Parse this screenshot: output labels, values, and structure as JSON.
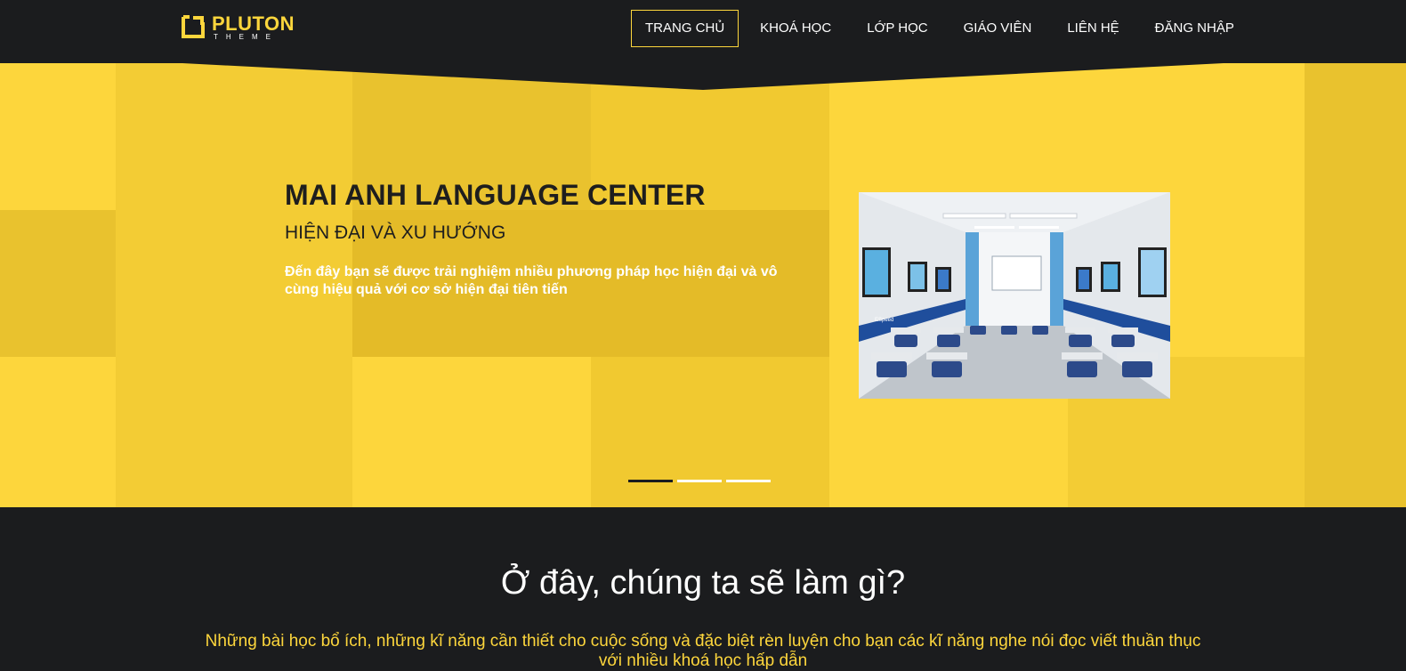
{
  "logo": {
    "name": "PLUTON",
    "sub": "THEME"
  },
  "nav": {
    "items": [
      {
        "label": "TRANG CHỦ"
      },
      {
        "label": "KHOÁ HỌC"
      },
      {
        "label": "LỚP HỌC"
      },
      {
        "label": "GIÁO VIÊN"
      },
      {
        "label": "LIÊN HỆ"
      },
      {
        "label": "ĐĂNG NHẬP"
      }
    ],
    "active_index": 0
  },
  "hero": {
    "title": "MAI ANH LANGUAGE CENTER",
    "subtitle": "HIỆN ĐẠI VÀ XU HƯỚNG",
    "description": "Đến đây bạn sẽ được trải nghiệm nhiều phương pháp học hiện đại và vô cùng hiệu quả với cơ sở hiện đại tiên tiến",
    "classroom_sign_text": "ESpeed",
    "slides_count": 3,
    "active_slide": 0
  },
  "section": {
    "title": "Ở đây, chúng ta sẽ làm gì?",
    "description": "Những bài học bổ ích, những kĩ năng cần thiết cho cuộc sống và đặc biệt rèn luyện cho bạn các kĩ năng nghe nói đọc viết thuần thục với nhiều khoá học hấp dẫn"
  },
  "colors": {
    "accent": "#fdd63c",
    "dark": "#1b1c1e",
    "tile_dark": "#e9c22e",
    "white": "#ffffff"
  }
}
